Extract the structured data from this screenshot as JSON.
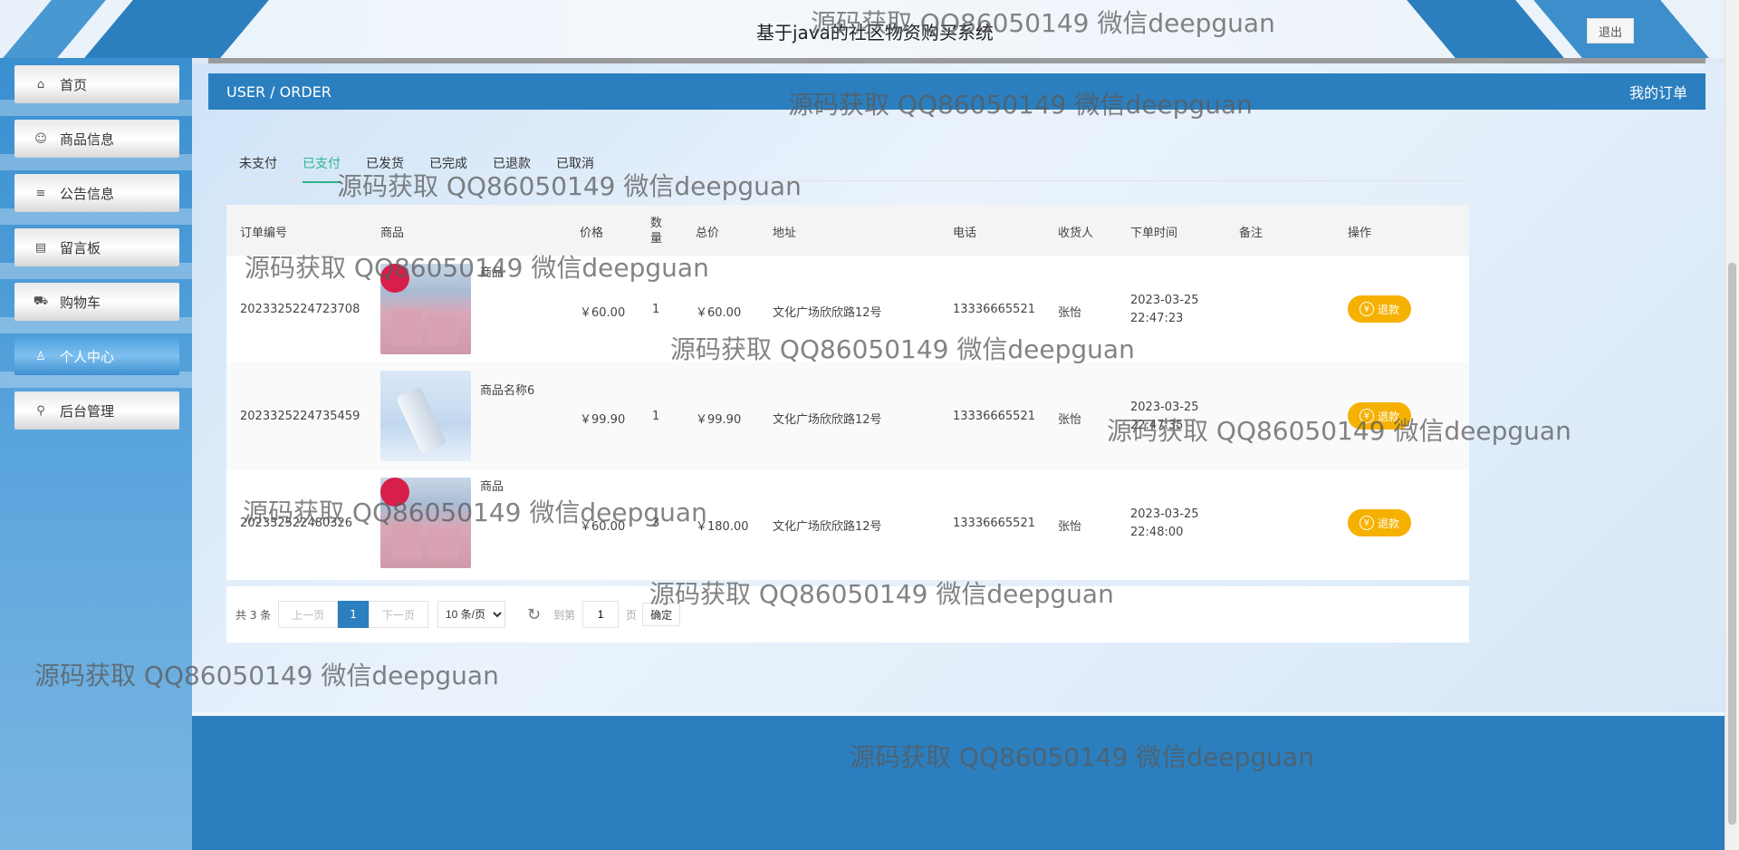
{
  "header": {
    "title": "基于java的社区物资购买系统",
    "logout_label": "退出"
  },
  "sidebar": {
    "items": [
      {
        "label": "首页",
        "icon": "home-icon",
        "glyph": "⌂"
      },
      {
        "label": "商品信息",
        "icon": "product-icon",
        "glyph": "☺"
      },
      {
        "label": "公告信息",
        "icon": "notice-icon",
        "glyph": "≡"
      },
      {
        "label": "留言板",
        "icon": "message-icon",
        "glyph": "▤"
      },
      {
        "label": "购物车",
        "icon": "cart-icon",
        "glyph": "⛟"
      },
      {
        "label": "个人中心",
        "icon": "user-icon",
        "glyph": "♙",
        "active": true
      },
      {
        "label": "后台管理",
        "icon": "link-icon",
        "glyph": "⚲"
      }
    ]
  },
  "breadcrumb": {
    "left": "USER / ORDER",
    "right": "我的订单"
  },
  "tabs": [
    "未支付",
    "已支付",
    "已发货",
    "已完成",
    "已退款",
    "已取消"
  ],
  "active_tab": "已支付",
  "table": {
    "headers": {
      "order_no": "订单编号",
      "product": "商品",
      "price": "价格",
      "qty": "数量",
      "total": "总价",
      "address": "地址",
      "phone": "电话",
      "receiver": "收货人",
      "time": "下单时间",
      "remark": "备注",
      "action": "操作"
    },
    "rows": [
      {
        "order_no": "2023325224723708",
        "product": "商品",
        "price": "￥60.00",
        "qty": "1",
        "total": "￥60.00",
        "address": "文化广场欣欣路12号",
        "phone": "13336665521",
        "receiver": "张怡",
        "time_date": "2023-03-25",
        "time_clock": "22:47:23",
        "remark": "",
        "action": "退款"
      },
      {
        "order_no": "2023325224735459",
        "product": "商品名称6",
        "price": "￥99.90",
        "qty": "1",
        "total": "￥99.90",
        "address": "文化广场欣欣路12号",
        "phone": "13336665521",
        "receiver": "张怡",
        "time_date": "2023-03-25",
        "time_clock": "22:47:35",
        "remark": "",
        "action": "退款"
      },
      {
        "order_no": "20233252248032​6",
        "product": "商品",
        "price": "￥60.00",
        "qty": "3",
        "total": "￥180.00",
        "address": "文化广场欣欣路12号",
        "phone": "13336665521",
        "receiver": "张怡",
        "time_date": "2023-03-25",
        "time_clock": "22:48:00",
        "remark": "",
        "action": "退款"
      }
    ]
  },
  "pager": {
    "total": "共 3 条",
    "prev": "上一页",
    "current": "1",
    "next": "下一页",
    "page_size": "10 条/页",
    "goto_label": "到第",
    "goto_value": "1",
    "page_label": "页",
    "confirm": "确定"
  },
  "watermark": "源码获取 QQ86050149 微信deepguan",
  "colors": {
    "primary": "#2b7fbf",
    "accent_green": "#2bb592",
    "refund_yellow": "#f6b100"
  }
}
